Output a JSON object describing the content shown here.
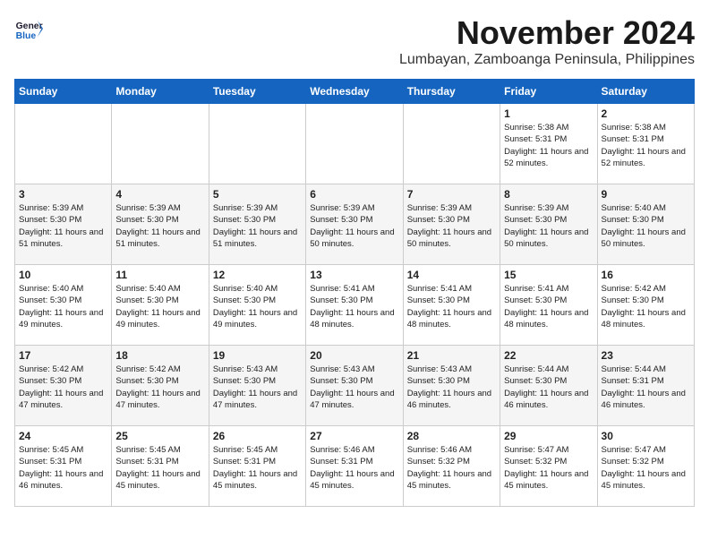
{
  "header": {
    "logo_line1": "General",
    "logo_line2": "Blue",
    "month_title": "November 2024",
    "location": "Lumbayan, Zamboanga Peninsula, Philippines"
  },
  "weekdays": [
    "Sunday",
    "Monday",
    "Tuesday",
    "Wednesday",
    "Thursday",
    "Friday",
    "Saturday"
  ],
  "weeks": [
    [
      {
        "day": "",
        "info": ""
      },
      {
        "day": "",
        "info": ""
      },
      {
        "day": "",
        "info": ""
      },
      {
        "day": "",
        "info": ""
      },
      {
        "day": "",
        "info": ""
      },
      {
        "day": "1",
        "info": "Sunrise: 5:38 AM\nSunset: 5:31 PM\nDaylight: 11 hours\nand 52 minutes."
      },
      {
        "day": "2",
        "info": "Sunrise: 5:38 AM\nSunset: 5:31 PM\nDaylight: 11 hours\nand 52 minutes."
      }
    ],
    [
      {
        "day": "3",
        "info": "Sunrise: 5:39 AM\nSunset: 5:30 PM\nDaylight: 11 hours\nand 51 minutes."
      },
      {
        "day": "4",
        "info": "Sunrise: 5:39 AM\nSunset: 5:30 PM\nDaylight: 11 hours\nand 51 minutes."
      },
      {
        "day": "5",
        "info": "Sunrise: 5:39 AM\nSunset: 5:30 PM\nDaylight: 11 hours\nand 51 minutes."
      },
      {
        "day": "6",
        "info": "Sunrise: 5:39 AM\nSunset: 5:30 PM\nDaylight: 11 hours\nand 50 minutes."
      },
      {
        "day": "7",
        "info": "Sunrise: 5:39 AM\nSunset: 5:30 PM\nDaylight: 11 hours\nand 50 minutes."
      },
      {
        "day": "8",
        "info": "Sunrise: 5:39 AM\nSunset: 5:30 PM\nDaylight: 11 hours\nand 50 minutes."
      },
      {
        "day": "9",
        "info": "Sunrise: 5:40 AM\nSunset: 5:30 PM\nDaylight: 11 hours\nand 50 minutes."
      }
    ],
    [
      {
        "day": "10",
        "info": "Sunrise: 5:40 AM\nSunset: 5:30 PM\nDaylight: 11 hours\nand 49 minutes."
      },
      {
        "day": "11",
        "info": "Sunrise: 5:40 AM\nSunset: 5:30 PM\nDaylight: 11 hours\nand 49 minutes."
      },
      {
        "day": "12",
        "info": "Sunrise: 5:40 AM\nSunset: 5:30 PM\nDaylight: 11 hours\nand 49 minutes."
      },
      {
        "day": "13",
        "info": "Sunrise: 5:41 AM\nSunset: 5:30 PM\nDaylight: 11 hours\nand 48 minutes."
      },
      {
        "day": "14",
        "info": "Sunrise: 5:41 AM\nSunset: 5:30 PM\nDaylight: 11 hours\nand 48 minutes."
      },
      {
        "day": "15",
        "info": "Sunrise: 5:41 AM\nSunset: 5:30 PM\nDaylight: 11 hours\nand 48 minutes."
      },
      {
        "day": "16",
        "info": "Sunrise: 5:42 AM\nSunset: 5:30 PM\nDaylight: 11 hours\nand 48 minutes."
      }
    ],
    [
      {
        "day": "17",
        "info": "Sunrise: 5:42 AM\nSunset: 5:30 PM\nDaylight: 11 hours\nand 47 minutes."
      },
      {
        "day": "18",
        "info": "Sunrise: 5:42 AM\nSunset: 5:30 PM\nDaylight: 11 hours\nand 47 minutes."
      },
      {
        "day": "19",
        "info": "Sunrise: 5:43 AM\nSunset: 5:30 PM\nDaylight: 11 hours\nand 47 minutes."
      },
      {
        "day": "20",
        "info": "Sunrise: 5:43 AM\nSunset: 5:30 PM\nDaylight: 11 hours\nand 47 minutes."
      },
      {
        "day": "21",
        "info": "Sunrise: 5:43 AM\nSunset: 5:30 PM\nDaylight: 11 hours\nand 46 minutes."
      },
      {
        "day": "22",
        "info": "Sunrise: 5:44 AM\nSunset: 5:30 PM\nDaylight: 11 hours\nand 46 minutes."
      },
      {
        "day": "23",
        "info": "Sunrise: 5:44 AM\nSunset: 5:31 PM\nDaylight: 11 hours\nand 46 minutes."
      }
    ],
    [
      {
        "day": "24",
        "info": "Sunrise: 5:45 AM\nSunset: 5:31 PM\nDaylight: 11 hours\nand 46 minutes."
      },
      {
        "day": "25",
        "info": "Sunrise: 5:45 AM\nSunset: 5:31 PM\nDaylight: 11 hours\nand 45 minutes."
      },
      {
        "day": "26",
        "info": "Sunrise: 5:45 AM\nSunset: 5:31 PM\nDaylight: 11 hours\nand 45 minutes."
      },
      {
        "day": "27",
        "info": "Sunrise: 5:46 AM\nSunset: 5:31 PM\nDaylight: 11 hours\nand 45 minutes."
      },
      {
        "day": "28",
        "info": "Sunrise: 5:46 AM\nSunset: 5:32 PM\nDaylight: 11 hours\nand 45 minutes."
      },
      {
        "day": "29",
        "info": "Sunrise: 5:47 AM\nSunset: 5:32 PM\nDaylight: 11 hours\nand 45 minutes."
      },
      {
        "day": "30",
        "info": "Sunrise: 5:47 AM\nSunset: 5:32 PM\nDaylight: 11 hours\nand 45 minutes."
      }
    ]
  ]
}
